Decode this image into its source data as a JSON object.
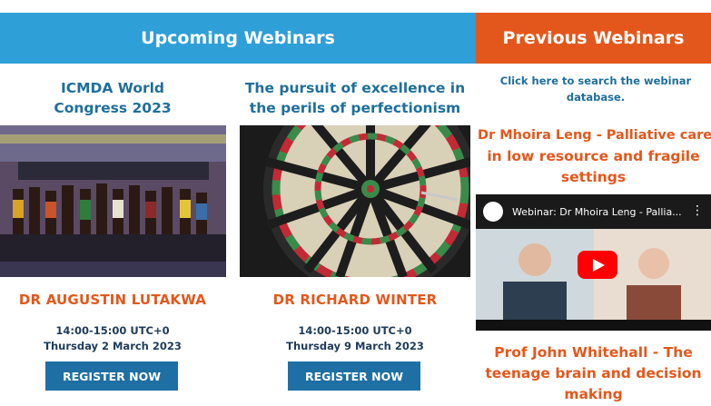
{
  "upcoming": {
    "header": "Upcoming Webinars",
    "cards": [
      {
        "title_line1": "ICMDA World",
        "title_line2": "Congress 2023",
        "speaker": "DR AUGUSTIN LUTAKWA",
        "time": "14:00-15:00 UTC+0",
        "date": "Thursday 2 March 2023",
        "button": "REGISTER NOW"
      },
      {
        "title_line1": "The pursuit of excellence in",
        "title_line2": "the perils of perfectionism",
        "speaker": "DR RICHARD WINTER",
        "time": "14:00-15:00 UTC+0",
        "date": "Thursday 9 March 2023",
        "button": "REGISTER NOW"
      }
    ]
  },
  "previous": {
    "header": "Previous Webinars",
    "search_line1": "Click here to search the webinar",
    "search_line2": "database.",
    "items": [
      {
        "title_line1": "Dr Mhoira Leng - Palliative care",
        "title_line2": "in low resource and fragile",
        "title_line3": "settings"
      },
      {
        "title_line1": "Prof John Whitehall - The",
        "title_line2": "teenage brain and decision",
        "title_line3": "making"
      }
    ],
    "video": {
      "title": "Webinar: Dr Mhoira Leng - Pallia...",
      "menu_icon": "more-vert-icon",
      "play_icon": "youtube-play-icon"
    }
  },
  "colors": {
    "blue_header": "#2f9fd8",
    "orange_header": "#e4571c",
    "title_blue": "#1e6f9c",
    "button_blue": "#1e6fa3"
  }
}
